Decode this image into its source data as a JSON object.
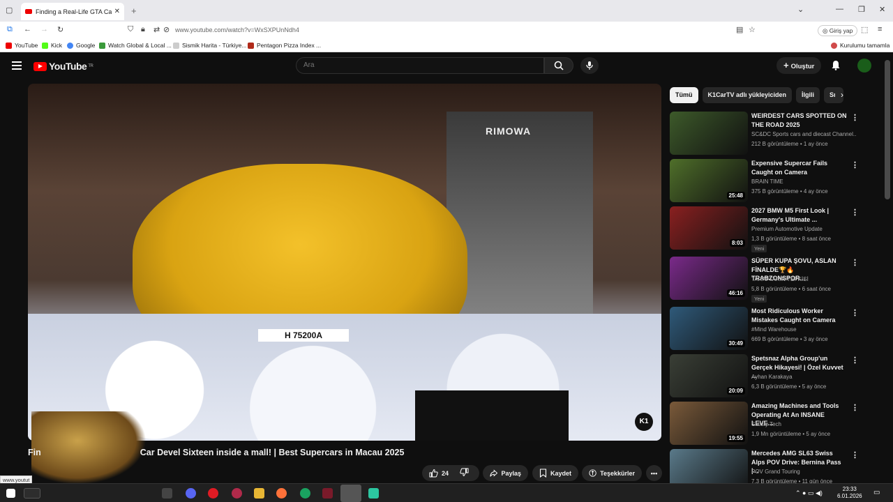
{
  "browser": {
    "tab_title": "Finding a Real-Life GTA Car Devi",
    "url": "www.youtube.com/watch?v=WxSXPUnNdh4",
    "login_label": "Giriş yap",
    "status_url": "www.youtut",
    "bookmarks": [
      "YouTube",
      "Kick",
      "Google",
      "Watch Global & Local ...",
      "Sismik Harita - Türkiye...",
      "Pentagon Pizza Index ...",
      "Kurulumu tamamla"
    ]
  },
  "header": {
    "logo": "YouTube",
    "region": "TR",
    "search_placeholder": "Ara",
    "create_label": "Oluştur"
  },
  "video": {
    "title": "Finding a Real-Life GTA Car Devel Sixteen inside a mall! | Best Supercars in Macau 2025",
    "title_visible": "Car Devel Sixteen inside a mall! | Best Supercars in Macau 2025",
    "title_prefix": "Fin",
    "store_sign": "RIMOWA",
    "plate": "H 75200A",
    "watermark": "K1",
    "like_count": "24",
    "share_label": "Paylaş",
    "save_label": "Kaydet",
    "thanks_label": "Teşekkürler"
  },
  "chips": [
    "Tümü",
    "K1CarTV adlı yükleyiciden",
    "İlgili",
    "Sı"
  ],
  "related": [
    {
      "title": "WEIRDEST CARS SPOTTED ON THE ROAD 2025",
      "channel": "SC&DC Sports cars and diecast Channel...",
      "meta": "212 B görüntüleme • 1 ay önce",
      "duration": "",
      "badge": "",
      "color": "#3d5a2a"
    },
    {
      "title": "Expensive Supercar Fails Caught on Camera",
      "channel": "BRAIN TIME",
      "meta": "375 B görüntüleme • 4 ay önce",
      "duration": "25:48",
      "badge": "",
      "color": "#4f6f2a"
    },
    {
      "title": "2027 BMW M5 First Look | Germany's Ultimate ...",
      "channel": "Premium Automotive Update",
      "meta": "1,3 B görüntüleme • 8 saat önce",
      "duration": "8:03",
      "badge": "Yeni",
      "color": "#8a2020"
    },
    {
      "title": "SÜPER KUPA ŞOVU, ASLAN FİNALDE🏆🔥 TRABZONSPOR...",
      "channel": "TARAFTARIN TEPKİSİ",
      "meta": "5,8 B görüntüleme • 6 saat önce",
      "duration": "46:16",
      "badge": "Yeni",
      "color": "#7a2a8a"
    },
    {
      "title": "Most Ridiculous Worker Mistakes Caught on Camera",
      "channel": "#Mind Warehouse",
      "meta": "669 B görüntüleme • 3 ay önce",
      "duration": "30:49",
      "badge": "",
      "color": "#2f5a7a"
    },
    {
      "title": "Spetsnaz Alpha Group'un Gerçek Hikayesi! | Özel Kuvvet ...",
      "channel": "Ayhan Karakaya",
      "meta": "6,3 B görüntüleme • 5 ay önce",
      "duration": "20:09",
      "badge": "",
      "color": "#3a3f36"
    },
    {
      "title": "Amazing Machines and Tools Operating At An INSANE LEVE...",
      "channel": "Satisfy Tech",
      "meta": "1,9 Mn görüntüleme • 5 ay önce",
      "duration": "19:55",
      "badge": "",
      "color": "#7a5a3a"
    },
    {
      "title": "Mercedes AMG SL63 Swiss Alps POV Drive: Bernina Pass |...",
      "channel": "POV Grand Touring",
      "meta": "7,3 B görüntüleme • 11 gün önce",
      "duration": "",
      "badge": "",
      "color": "#5a7a8a"
    }
  ],
  "taskbar": {
    "time": "23:33",
    "date": "6.01.2026"
  }
}
